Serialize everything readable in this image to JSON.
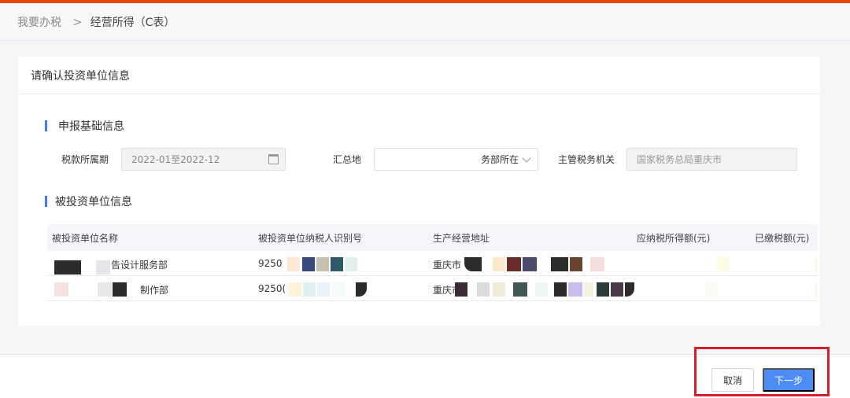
{
  "breadcrumb": {
    "home": "我要办税",
    "separator": ">",
    "current": "经营所得（C表）"
  },
  "card": {
    "header": "请确认投资单位信息"
  },
  "basic_info": {
    "section_title": "申报基础信息",
    "period_label": "税款所属期",
    "period_value": "2022-01至2022-12",
    "summary_label": "汇总地",
    "summary_value": "务部所在",
    "tax_authority_label": "主管税务机关",
    "tax_authority_value": "国家税务总局重庆市"
  },
  "invest_info": {
    "section_title": "被投资单位信息",
    "columns": {
      "name": "被投资单位名称",
      "tax_id": "被投资单位纳税人识别号",
      "address": "生产经营地址",
      "taxable_income": "应纳税所得额(元)",
      "paid_tax": "已缴税额(元)"
    },
    "rows": [
      {
        "name": "告设计服务部",
        "tax_id": "9250",
        "address": "重庆市"
      },
      {
        "name": "制作部",
        "tax_id": "9250(",
        "address": "重庆市"
      }
    ]
  },
  "footer": {
    "cancel": "取消",
    "next": "下一步"
  },
  "colors": {
    "accent": "#4d8bf5",
    "topbar": "#e8430a",
    "highlight": "#d81e2a"
  }
}
